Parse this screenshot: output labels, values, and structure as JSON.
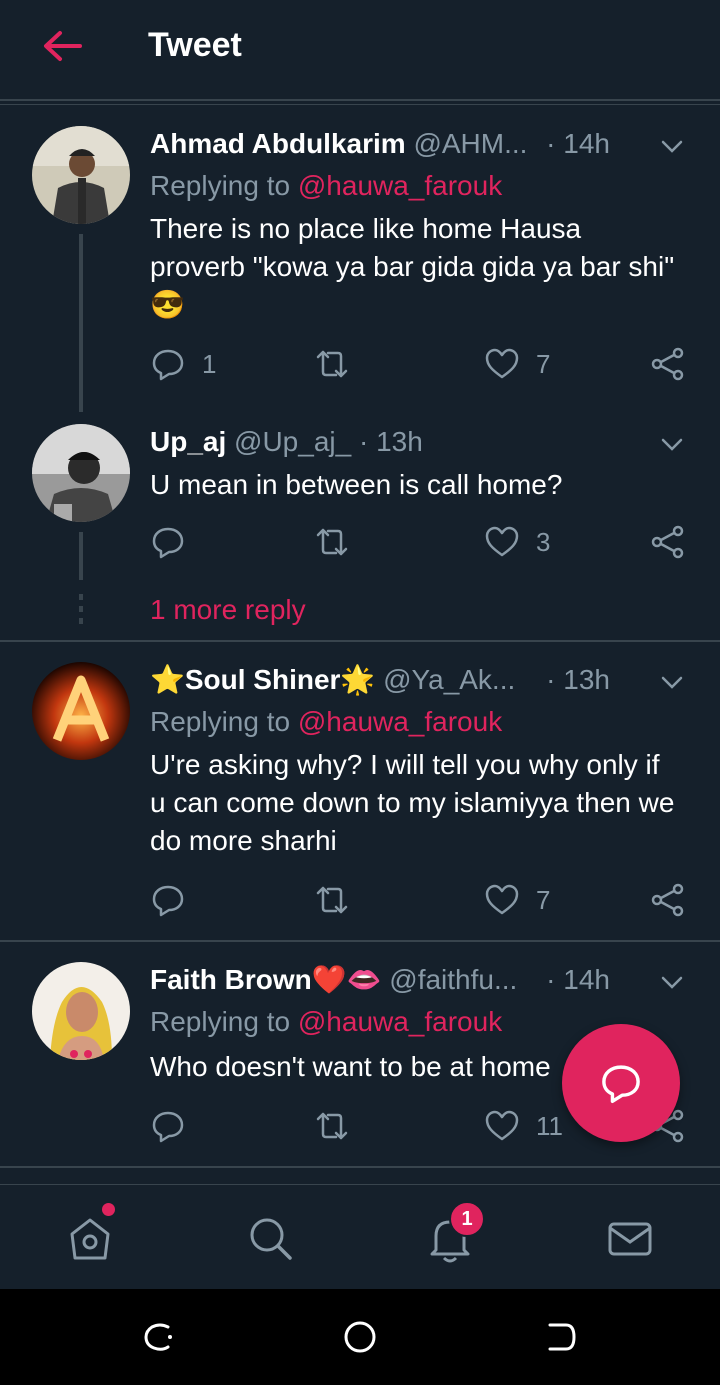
{
  "header": {
    "title": "Tweet"
  },
  "tweets": [
    {
      "name": "Ahmad Abdulkarim",
      "handle": "@AHM...",
      "time": "· 14h",
      "replying_prefix": "Replying to ",
      "replying_handle": "@hauwa_farouk",
      "text": "There is no place like home Hausa proverb \"kowa ya bar gida gida ya bar shi\" 😎",
      "reply_count": "1",
      "retweet_count": "",
      "like_count": "7"
    },
    {
      "name": "Up_aj",
      "handle": "@Up_aj_",
      "time": "· 13h",
      "text": "U mean in between is call home?",
      "reply_count": "",
      "retweet_count": "",
      "like_count": "3"
    },
    {
      "name": "⭐Soul Shiner🌟",
      "handle": "@Ya_Ak...",
      "time": "· 13h",
      "replying_prefix": "Replying to ",
      "replying_handle": "@hauwa_farouk",
      "text": "U're asking why? I will tell you why only if u can come down to my islamiyya then we do more sharhi",
      "reply_count": "",
      "retweet_count": "",
      "like_count": "7"
    },
    {
      "name": "Faith Brown❤️👄",
      "handle": "@faithfu...",
      "time": "· 14h",
      "replying_prefix": "Replying to ",
      "replying_handle": "@hauwa_farouk",
      "text": "Who doesn't want to be at home",
      "reply_count": "",
      "retweet_count": "",
      "like_count": "11"
    }
  ],
  "more_replies": "1 more reply",
  "tabbar": {
    "notifications_badge": "1"
  },
  "colors": {
    "accent": "#e0245e",
    "background": "#15202b",
    "muted": "#8899a6",
    "divider": "#38444d"
  },
  "icons": [
    "back-arrow-icon",
    "chevron-down-icon",
    "reply-icon",
    "retweet-icon",
    "like-icon",
    "share-icon",
    "compose-reply-icon",
    "home-icon",
    "search-icon",
    "bell-icon",
    "mail-icon"
  ]
}
